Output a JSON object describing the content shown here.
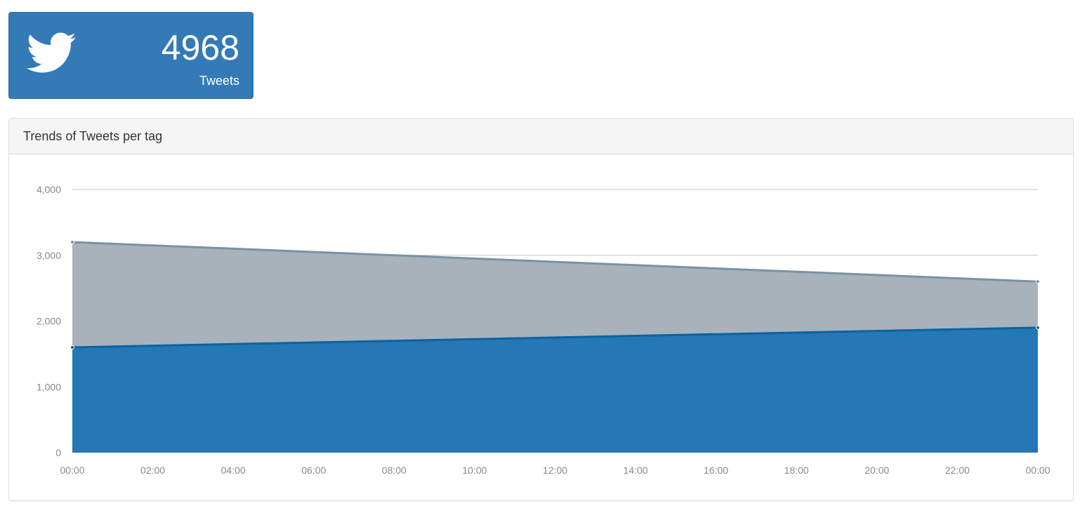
{
  "stat": {
    "count": "4968",
    "label": "Tweets",
    "icon": "twitter-bird-icon",
    "background": "#337ab7"
  },
  "panel": {
    "title": "Trends of Tweets per tag"
  },
  "chart_data": {
    "type": "area",
    "stacked": true,
    "title": "Trends of Tweets per tag",
    "xlabel": "",
    "ylabel": "",
    "x_ticks": [
      "00:00",
      "02:00",
      "04:00",
      "06:00",
      "08:00",
      "10:00",
      "12:00",
      "14:00",
      "16:00",
      "18:00",
      "20:00",
      "22:00",
      "00:00"
    ],
    "x": [
      "00:00",
      "00:00"
    ],
    "ylim": [
      0,
      4000
    ],
    "y_ticks": [
      0,
      1000,
      2000,
      3000,
      4000
    ],
    "y_tick_labels": [
      "0",
      "1,000",
      "2,000",
      "3,000",
      "4,000"
    ],
    "grid": true,
    "series": [
      {
        "values": [
          1600,
          1900
        ],
        "fill": "#2677b5",
        "line": "#0b62a4"
      },
      {
        "values": [
          1600,
          700
        ],
        "fill": "#a8b2bb",
        "line": "#7a92a3"
      }
    ]
  }
}
